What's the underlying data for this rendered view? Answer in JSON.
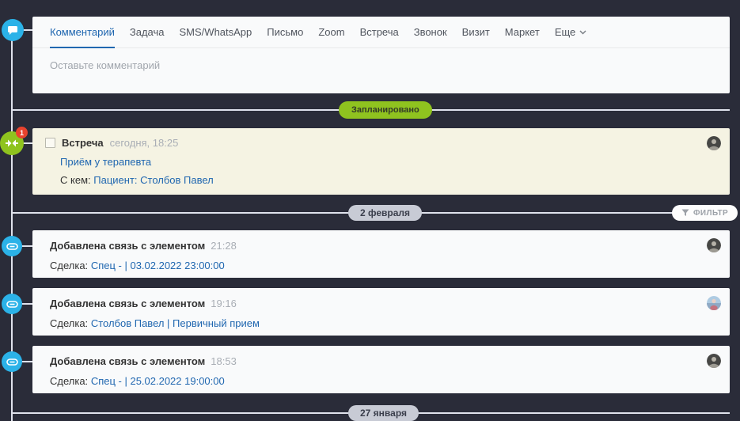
{
  "colors": {
    "accent_blue": "#2067b0",
    "timeline_blue": "#2bb2e8",
    "green": "#8fc31f",
    "red_badge": "#e8432e",
    "bg_dark": "#2a2c39",
    "card_cream": "#f5f3e3",
    "card_white": "#f9fafb"
  },
  "tabs": {
    "items": [
      {
        "label": "Комментарий"
      },
      {
        "label": "Задача"
      },
      {
        "label": "SMS/WhatsApp"
      },
      {
        "label": "Письмо"
      },
      {
        "label": "Zoom"
      },
      {
        "label": "Встреча"
      },
      {
        "label": "Звонок"
      },
      {
        "label": "Визит"
      },
      {
        "label": "Маркет"
      },
      {
        "label": "Еще"
      }
    ]
  },
  "composer": {
    "placeholder": "Оставьте комментарий"
  },
  "planned": {
    "label": "Запланировано"
  },
  "meeting": {
    "badge_count": "1",
    "title": "Встреча",
    "time": "сегодня, 18:25",
    "subject": "Приём у терапевта",
    "with_label": "С кем:",
    "with_link": "Пациент: Столбов Павел"
  },
  "separators": {
    "date1": "2 февраля",
    "date2": "27 января"
  },
  "filter": {
    "label": "ФИЛЬТР"
  },
  "cards": [
    {
      "title": "Добавлена связь с элементом",
      "time": "21:28",
      "label": "Сделка:",
      "link": "Спец - | 03.02.2022 23:00:00"
    },
    {
      "title": "Добавлена связь с элементом",
      "time": "19:16",
      "label": "Сделка:",
      "link": "Столбов Павел | Первичный прием"
    },
    {
      "title": "Добавлена связь с элементом",
      "time": "18:53",
      "label": "Сделка:",
      "link": "Спец - | 25.02.2022 19:00:00"
    }
  ]
}
